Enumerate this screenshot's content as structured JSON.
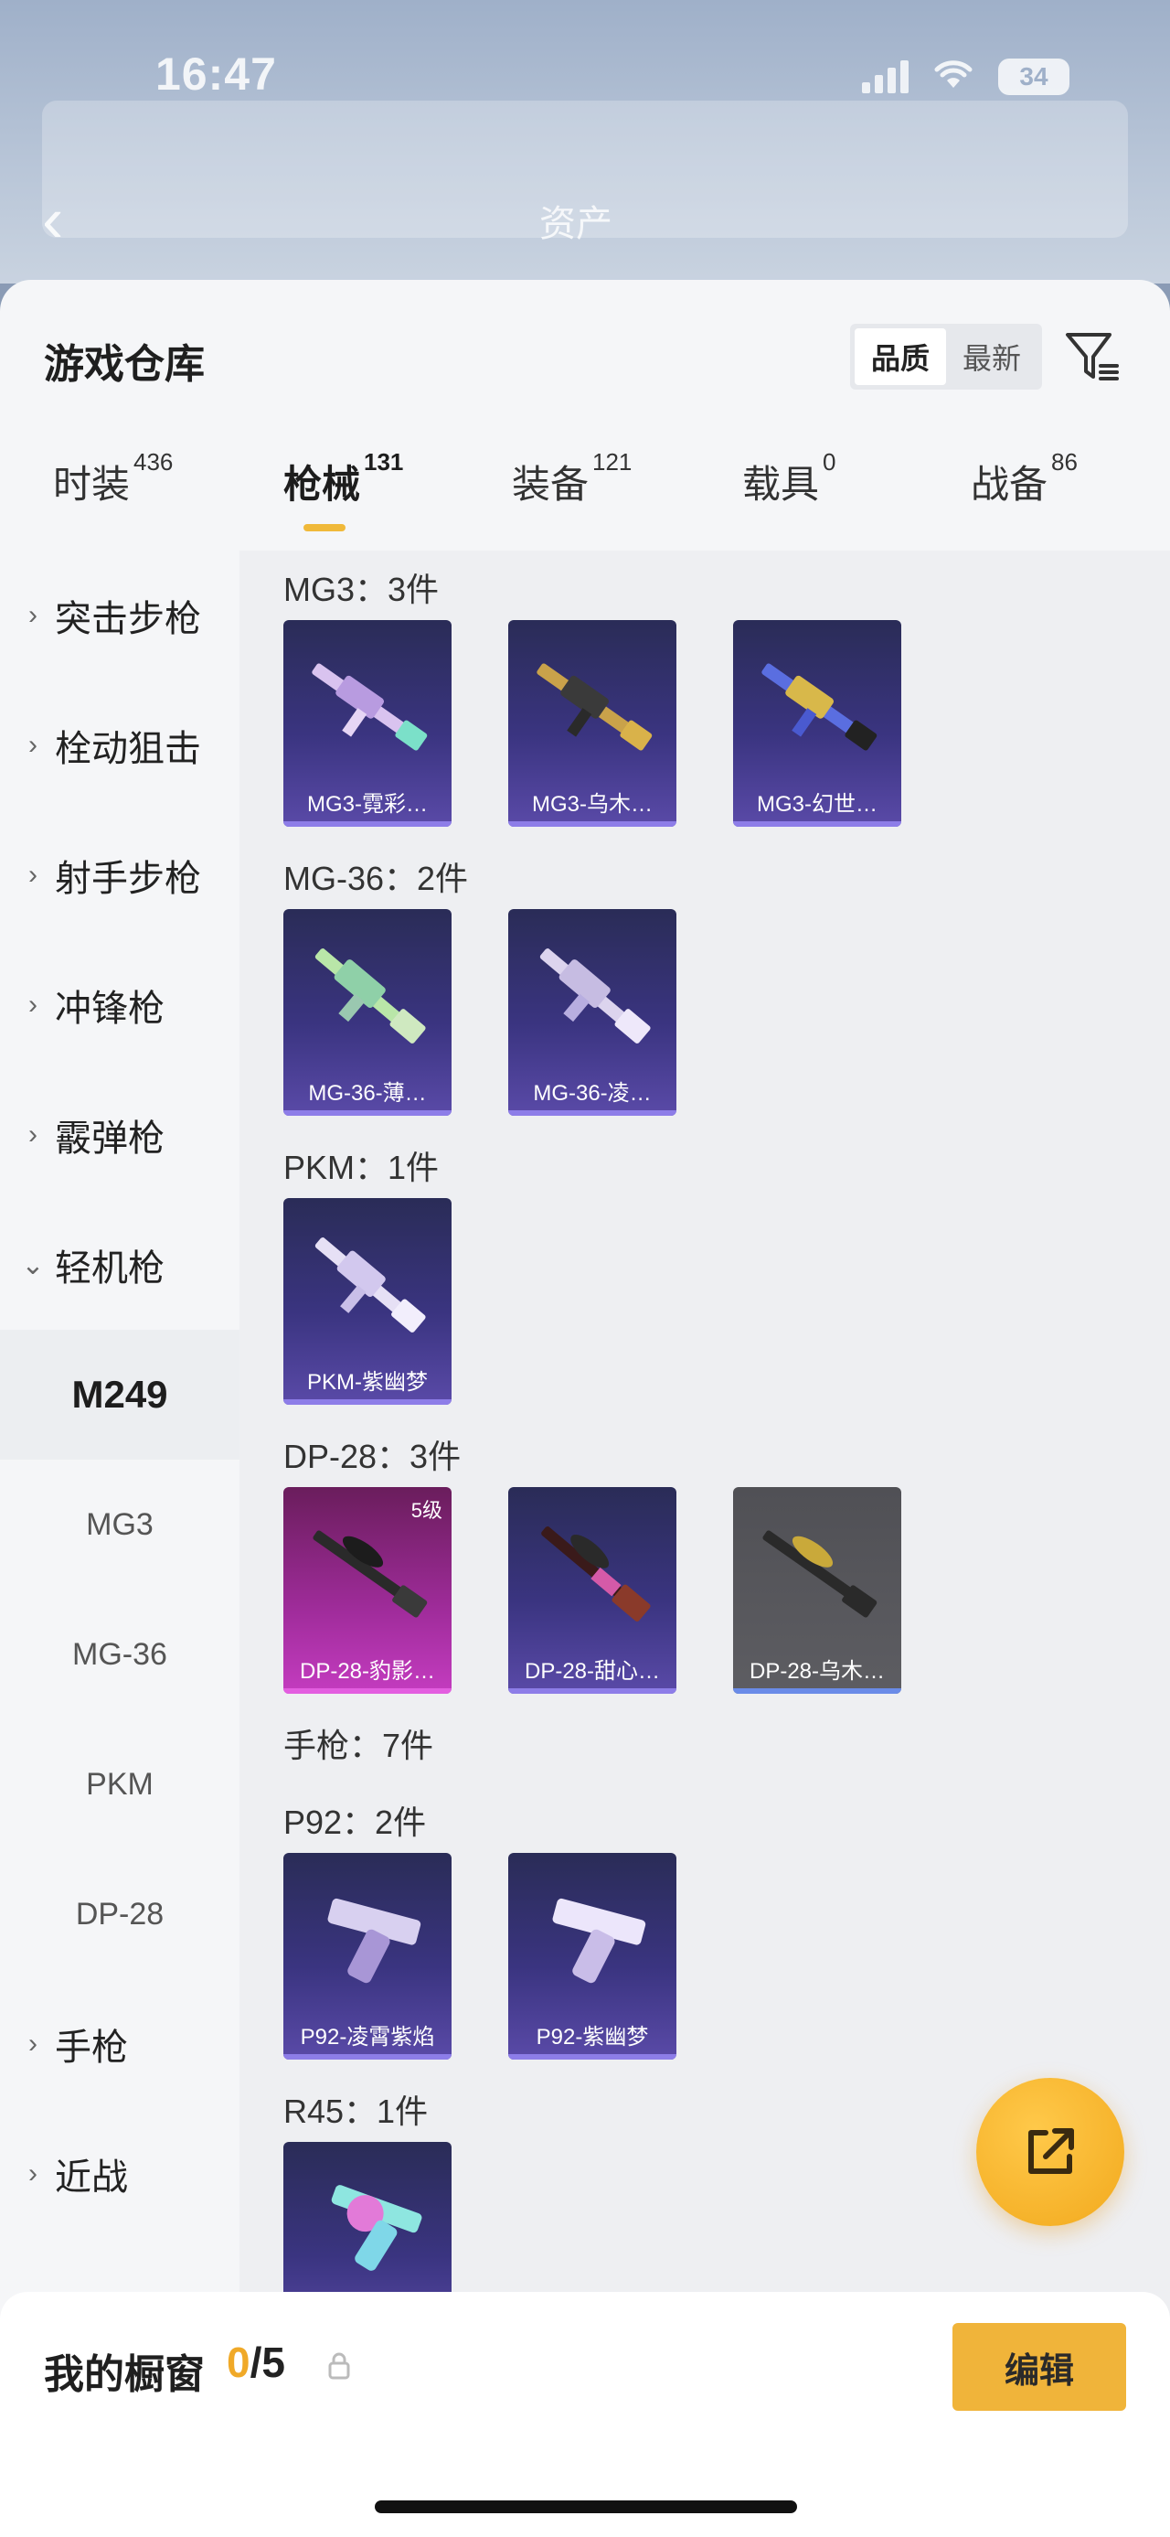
{
  "status": {
    "time": "16:47",
    "battery": "34"
  },
  "header": {
    "title_blurred": "资产"
  },
  "sheet": {
    "title": "游戏仓库",
    "sort": {
      "quality": "品质",
      "newest": "最新"
    }
  },
  "tabs": [
    {
      "label": "时装",
      "count": "436"
    },
    {
      "label": "枪械",
      "count": "131"
    },
    {
      "label": "装备",
      "count": "121"
    },
    {
      "label": "载具",
      "count": "0"
    },
    {
      "label": "战备",
      "count": "86"
    }
  ],
  "sidebar": {
    "categories": [
      "突击步枪",
      "栓动狙击",
      "射手步枪",
      "冲锋枪",
      "霰弹枪",
      "轻机枪"
    ],
    "sub": [
      "M249",
      "MG3",
      "MG-36",
      "PKM",
      "DP-28"
    ],
    "bottom": [
      "手枪",
      "近战"
    ]
  },
  "groups": [
    {
      "label": "MG3：3件",
      "items": [
        {
          "name": "MG3-霓彩…",
          "style": "purple"
        },
        {
          "name": "MG3-乌木…",
          "style": "purple"
        },
        {
          "name": "MG3-幻世…",
          "style": "purple"
        }
      ]
    },
    {
      "label": "MG-36：2件",
      "items": [
        {
          "name": "MG-36-薄…",
          "style": "purple"
        },
        {
          "name": "MG-36-凌…",
          "style": "purple"
        }
      ]
    },
    {
      "label": "PKM：1件",
      "items": [
        {
          "name": "PKM-紫幽梦",
          "style": "purple"
        }
      ]
    },
    {
      "label": "DP-28：3件",
      "items": [
        {
          "name": "DP-28-豹影…",
          "style": "pink",
          "level": "5级"
        },
        {
          "name": "DP-28-甜心…",
          "style": "purple"
        },
        {
          "name": "DP-28-乌木…",
          "style": "gray"
        }
      ]
    },
    {
      "label": "手枪：7件",
      "items": []
    },
    {
      "label": "P92：2件",
      "items": [
        {
          "name": "P92-凌霄紫焰",
          "style": "purple"
        },
        {
          "name": "P92-紫幽梦",
          "style": "purple"
        }
      ]
    },
    {
      "label": "R45：1件",
      "items": [
        {
          "name": "",
          "style": "purple"
        }
      ]
    }
  ],
  "bottom": {
    "title": "我的橱窗",
    "current": "0",
    "total": "/5",
    "edit": "编辑"
  },
  "colors": {
    "accent": "#f0b43a",
    "card_purple": "#3a3480",
    "card_pink": "#c43cc0"
  }
}
